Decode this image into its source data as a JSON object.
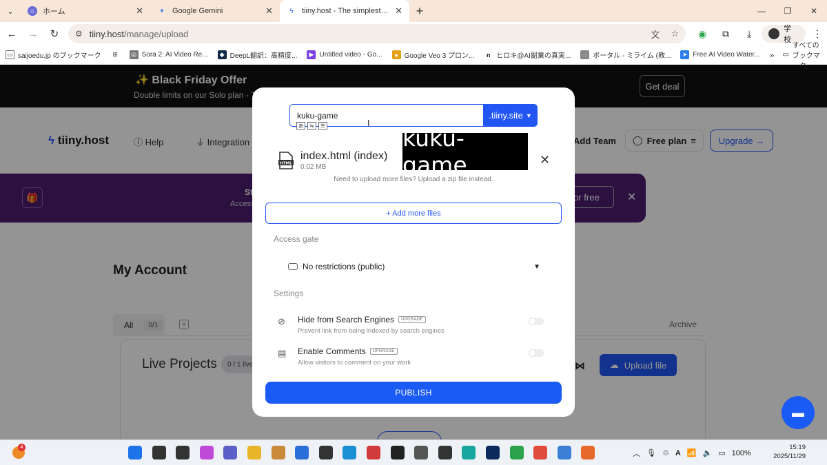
{
  "browser": {
    "tabs": [
      {
        "title": "ホーム",
        "icon": "home-app-icon",
        "color": "#6b6bd6"
      },
      {
        "title": "Google Gemini",
        "icon": "gemini-icon",
        "color": "#4a7cf0"
      },
      {
        "title": "tiiny.host - The simplest way to",
        "icon": "tiiny-bolt-icon",
        "color": "#2156f3"
      }
    ],
    "url_host": "tiiny.host",
    "url_path": "/manage/upload",
    "profile_label": "学校",
    "bookmarks": [
      {
        "label": "saijoedu.jp のブックマーク",
        "color": "#666"
      },
      {
        "label": "",
        "color": "#444"
      },
      {
        "label": "Sora 2: AI Video Re...",
        "color": "#777"
      },
      {
        "label": "DeepL翻訳：高精度...",
        "color": "#0f2b46"
      },
      {
        "label": "Untitled video - Go...",
        "color": "#7b3fe4"
      },
      {
        "label": "Google Veo 3 プロン...",
        "color": "#e4a017"
      },
      {
        "label": "ヒロキ@AI副業の真実...",
        "color": "#111"
      },
      {
        "label": "ポータル - ミライム (教...",
        "color": "#888"
      },
      {
        "label": "Free AI Video Water...",
        "color": "#2b7de9"
      }
    ],
    "all_bookmarks_label": "すべてのブックマーク"
  },
  "promo": {
    "title": "✨ Black Friday Offer",
    "subtitle": "Double limits on our Solo plan - Twi",
    "cta": "Get deal"
  },
  "site_nav": {
    "logo": "tiiny.host",
    "help": "Help",
    "integrations": "Integration",
    "add_team": "Add Team",
    "plan": "Free plan",
    "upgrade": "Upgrade →"
  },
  "banner": {
    "title": "St",
    "subtitle": "Access",
    "button": "t for free"
  },
  "account": {
    "title": "My Account",
    "tab_all": "All",
    "tab_all_count": "0/1",
    "archive": "Archive",
    "live_projects": "Live Projects",
    "live_count": "0 / 1 live",
    "upload_file": "Upload file"
  },
  "modal": {
    "site_name_value": "kuku-game",
    "domain_suffix": ".tiiny.site",
    "ime_candidate": "kuku-game",
    "file_name": "index.html (index)",
    "file_size": "0.02 MB",
    "zip_hint": "Need to upload more files? Upload a zip file instead.",
    "add_more_files": "+ Add more files",
    "access_gate_label": "Access gate",
    "access_option": "No restrictions (public)",
    "settings_label": "Settings",
    "settings": [
      {
        "title": "Hide from Search Engines",
        "badge": "UPGRADE",
        "desc": "Prevent link from being indexed by search engines",
        "icon": "eye-off-icon",
        "enabled": false
      },
      {
        "title": "Enable Comments",
        "badge": "UPGRADE",
        "desc": "Allow visitors to comment on your work",
        "icon": "comment-icon",
        "enabled": false
      }
    ],
    "publish": "PUBLISH"
  },
  "taskbar": {
    "notification_count": "4",
    "battery": "100%",
    "time": "15:19",
    "date": "2025/11/29",
    "apps": [
      {
        "name": "start-icon",
        "color": "#1e73e8"
      },
      {
        "name": "search-icon",
        "color": "#333"
      },
      {
        "name": "task-view-icon",
        "color": "#333"
      },
      {
        "name": "copilot-icon",
        "color": "#c04ad8"
      },
      {
        "name": "teams-icon",
        "color": "#5b5fc7"
      },
      {
        "name": "file-explorer-icon",
        "color": "#e8b52a"
      },
      {
        "name": "app-icon-1",
        "color": "#c98a3a"
      },
      {
        "name": "app-icon-2",
        "color": "#2a6fd8"
      },
      {
        "name": "app-icon-3",
        "color": "#333"
      },
      {
        "name": "edge-icon",
        "color": "#1b8fd6"
      },
      {
        "name": "app-icon-4",
        "color": "#d23b3b"
      },
      {
        "name": "chatgpt-icon",
        "color": "#222"
      },
      {
        "name": "app-icon-5",
        "color": "#555"
      },
      {
        "name": "app-icon-6",
        "color": "#333"
      },
      {
        "name": "app-icon-7",
        "color": "#18a7a0"
      },
      {
        "name": "app-icon-8",
        "color": "#0d2a5c"
      },
      {
        "name": "chrome-icon",
        "color": "#2ba24c"
      },
      {
        "name": "chrome-icon-2",
        "color": "#e04b3b"
      },
      {
        "name": "notepad-icon",
        "color": "#3b7fd6"
      },
      {
        "name": "firefox-icon",
        "color": "#e86a2a"
      }
    ]
  }
}
